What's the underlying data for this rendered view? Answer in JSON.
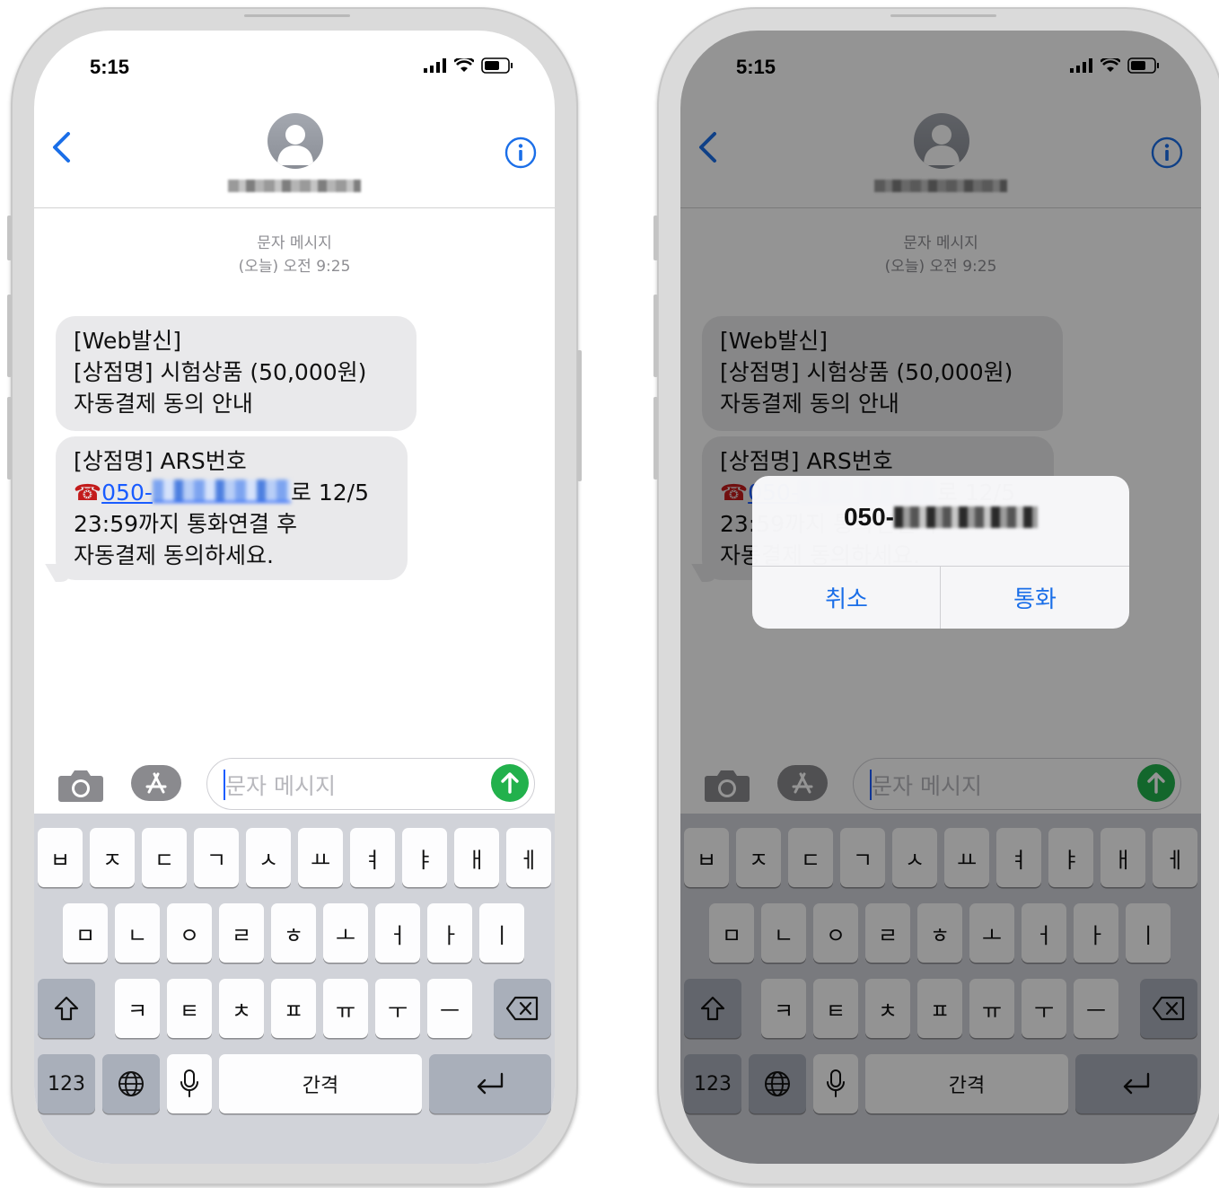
{
  "status_bar": {
    "time": "5:15"
  },
  "thread": {
    "header_label": "문자 메시지",
    "header_time": "(오늘) 오전 9:25"
  },
  "messages": [
    {
      "lines": [
        "[Web발신]",
        "[상점명] 시험상품 (50,000원)",
        "자동결제 동의 안내"
      ]
    },
    {
      "line1": "[상점명] ARS번호",
      "phone_glyph": "☎",
      "number_prefix": "050-",
      "after_number": "로 12/5",
      "line3": "23:59까지 통화연결 후",
      "line4": "자동결제 동의하세요."
    }
  ],
  "input": {
    "placeholder": "문자 메시지"
  },
  "keyboard": {
    "row1": [
      "ㅂ",
      "ㅈ",
      "ㄷ",
      "ㄱ",
      "ㅅ",
      "ㅛ",
      "ㅕ",
      "ㅑ",
      "ㅐ",
      "ㅔ"
    ],
    "row2": [
      "ㅁ",
      "ㄴ",
      "ㅇ",
      "ㄹ",
      "ㅎ",
      "ㅗ",
      "ㅓ",
      "ㅏ",
      "ㅣ"
    ],
    "row3": [
      "ㅋ",
      "ㅌ",
      "ㅊ",
      "ㅍ",
      "ㅠ",
      "ㅜ",
      "ㅡ"
    ],
    "numbers_label": "123",
    "space_label": "간격"
  },
  "call_alert": {
    "number_prefix": "050-",
    "cancel_label": "취소",
    "call_label": "통화"
  },
  "icons": [
    "back-chevron-icon",
    "info-icon",
    "avatar-silhouette-icon",
    "camera-icon",
    "app-store-icon",
    "send-arrow-icon",
    "shift-icon",
    "delete-icon",
    "globe-icon",
    "microphone-icon",
    "return-icon",
    "signal-icon",
    "wifi-icon",
    "battery-icon"
  ],
  "colors": {
    "link_blue": "#1a5cff",
    "send_green": "#22b14c",
    "bubble_gray": "#e9e9eb",
    "keyboard_bg": "#d1d3d9"
  }
}
